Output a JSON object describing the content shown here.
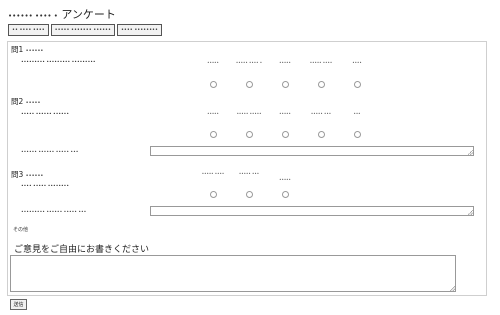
{
  "header": {
    "title_prefix": "•••••• •••• •",
    "title_main": "アンケート"
  },
  "tabs": [
    {
      "label": "•• •••• ••••"
    },
    {
      "label": "••••• ••••••• ••••••"
    },
    {
      "label": "•••• ••••••••"
    }
  ],
  "q1": {
    "title": "問1",
    "title_sub": "••••••",
    "prompt": "••••••••• ••••••••• •••••••••",
    "options": [
      "•••••",
      "••••• •••• •",
      "•••••",
      "••••• ••••",
      "••••"
    ]
  },
  "q2": {
    "title": "問2",
    "title_sub": "•••••",
    "prompt": "••••• •••••• ••••••",
    "options": [
      "•••••",
      "••••• •••••",
      "•••••",
      "••••• •••",
      "•••"
    ],
    "reason_label": "•••••• •••••• ••••• •••"
  },
  "q3": {
    "title": "問3",
    "title_sub": "••••••",
    "prompt": "•••• ••••• ••••••••",
    "options": [
      "••••• ••••",
      "••••• •••",
      "•••••"
    ],
    "reason_label": "••••••••• •••••• ••••• •••"
  },
  "other": {
    "label": "その他"
  },
  "opinion": {
    "label": "ご意見をご自由にお書きください",
    "value": ""
  },
  "submit": {
    "label": "送信"
  }
}
